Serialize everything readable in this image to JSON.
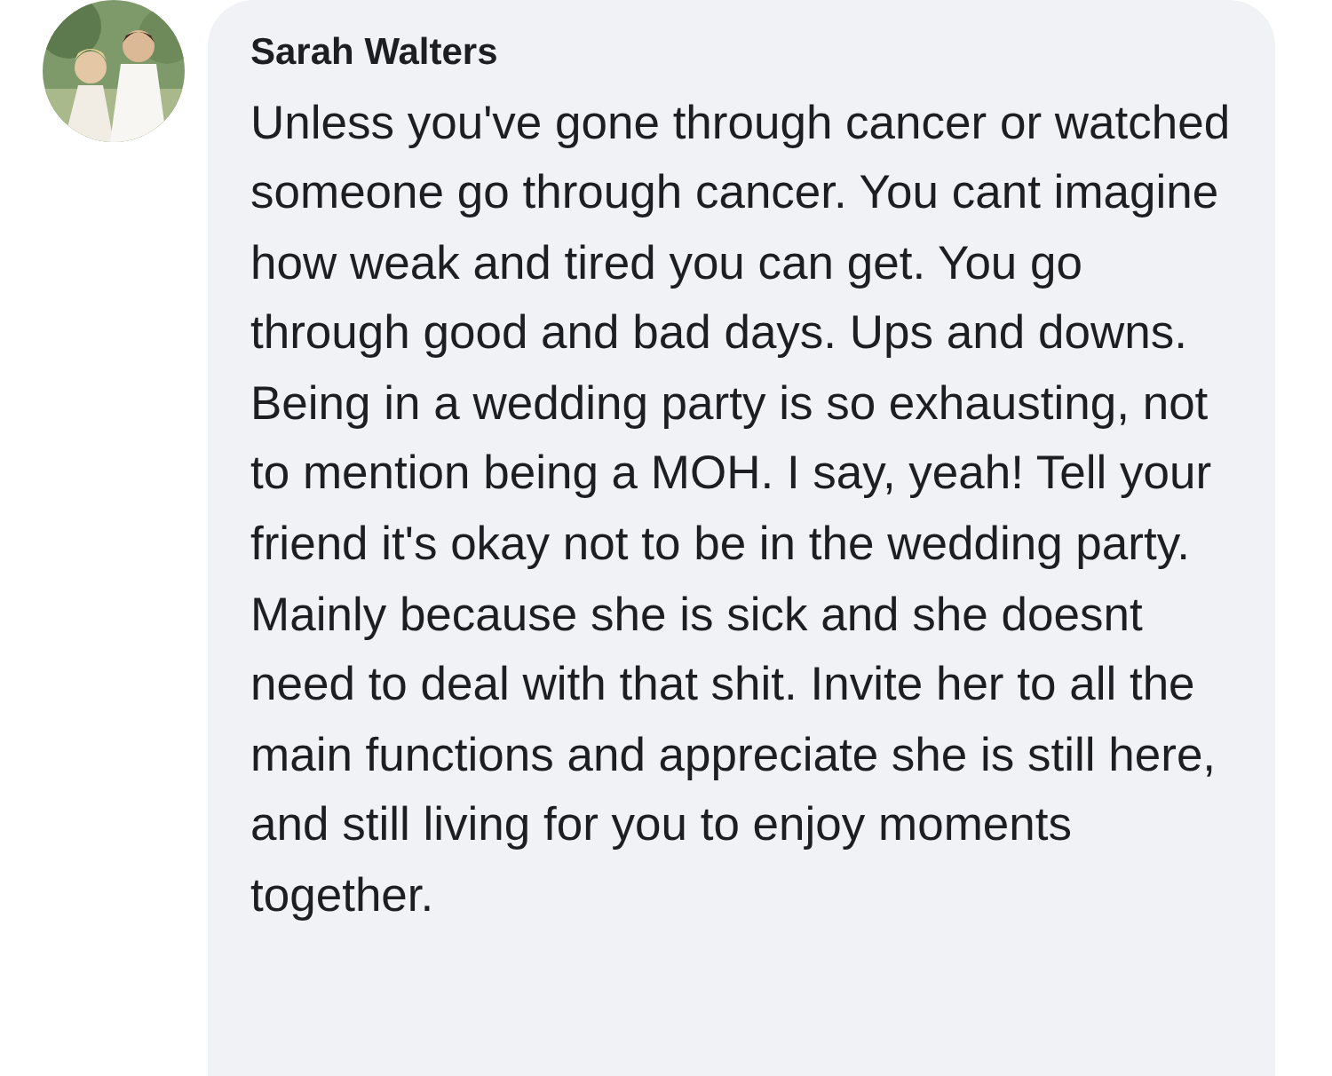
{
  "comment": {
    "author": "Sarah Walters",
    "text": "Unless you've gone through cancer or watched someone go through cancer. You cant imagine how weak and tired you can get. You go through good and bad days. Ups and downs. Being in a wedding party is so exhausting, not to mention being a MOH. I say, yeah! Tell your friend it's okay not to be in the wedding party. Mainly because she is sick and she doesnt need to deal with that shit. Invite her to all the main functions and appreciate she is still here, and still living for you to enjoy moments together."
  }
}
